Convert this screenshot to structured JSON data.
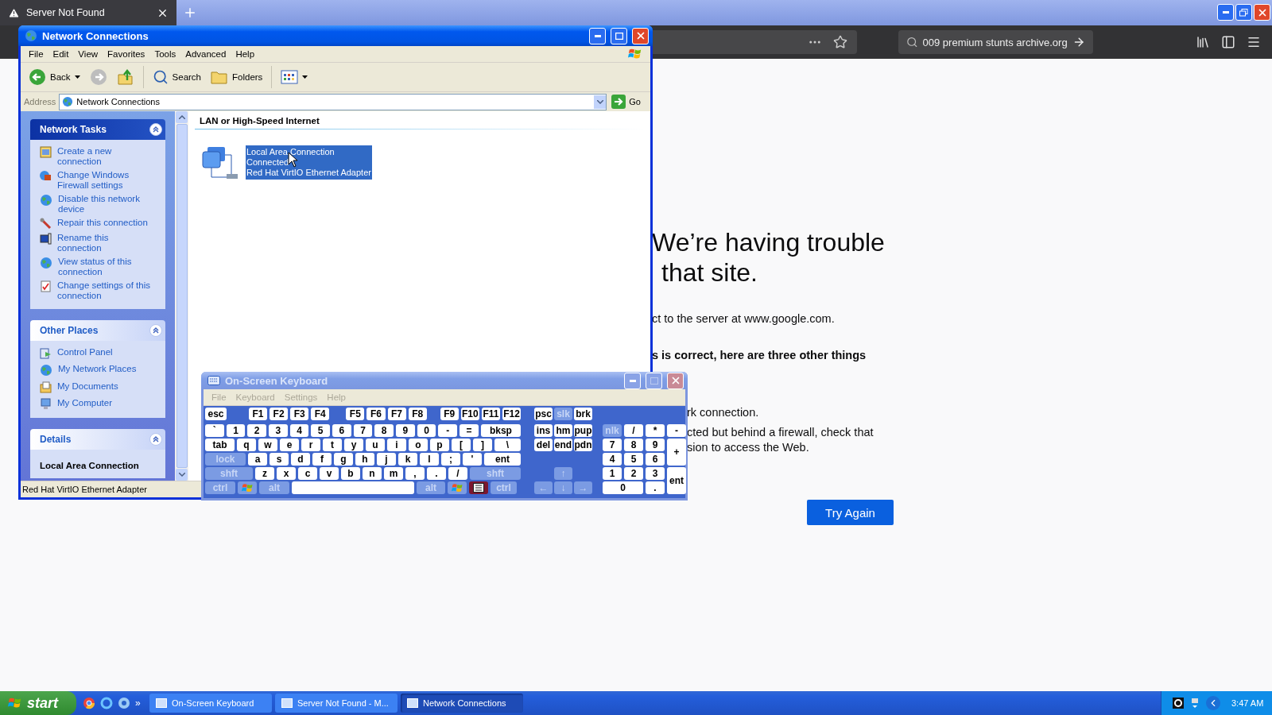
{
  "browser": {
    "tab": {
      "title": "Server Not Found",
      "selected": true
    },
    "search": {
      "value": "009 premium stunts archive.org"
    }
  },
  "error_page": {
    "heading": [
      "We’re having trouble",
      "that site."
    ],
    "lines": [
      {
        "text": "ct to the server at www.google.com.",
        "kind": "plain"
      },
      {
        "text": "s is correct, here are three other things",
        "kind": "bold"
      },
      {
        "text": "rk connection.",
        "kind": "item"
      },
      {
        "text": "cted but behind a firewall, check that",
        "kind": "item"
      },
      {
        "text": "sion to access the Web.",
        "kind": "cont"
      }
    ],
    "button": "Try Again"
  },
  "network_window": {
    "title": "Network Connections",
    "active": true,
    "menu": [
      "File",
      "Edit",
      "View",
      "Favorites",
      "Tools",
      "Advanced",
      "Help"
    ],
    "toolbar": [
      {
        "label": "Back",
        "kind": "back"
      },
      {
        "kind": "forward"
      },
      {
        "kind": "up"
      },
      {
        "label": "Search",
        "kind": "search"
      },
      {
        "label": "Folders",
        "kind": "folders"
      },
      {
        "kind": "views"
      }
    ],
    "address": {
      "label": "Address",
      "value": "Network Connections",
      "go": "Go"
    },
    "panels": [
      {
        "title": "Network Tasks",
        "kind": "primary",
        "expanded": true,
        "items": [
          "Create a new connection",
          "Change Windows Firewall settings",
          "Disable this network device",
          "Repair this connection",
          "Rename this connection",
          "View status of this connection",
          "Change settings of this connection"
        ]
      },
      {
        "title": "Other Places",
        "kind": "links",
        "expanded": true,
        "items": [
          "Control Panel",
          "My Network Places",
          "My Documents",
          "My Computer"
        ]
      },
      {
        "title": "Details",
        "kind": "details",
        "expanded": true,
        "items": [
          "Local Area Connection"
        ]
      }
    ],
    "group": {
      "title": "LAN or High-Speed Internet",
      "item": {
        "lines": [
          "Local Area Connection",
          "Connected",
          "Red Hat VirtIO Ethernet Adapter"
        ],
        "selected": true
      }
    },
    "status": "Red Hat VirtIO Ethernet Adapter"
  },
  "keyboard_window": {
    "title": "On-Screen Keyboard",
    "active": false,
    "menu": [
      "File",
      "Keyboard",
      "Settings",
      "Help"
    ],
    "main_rows": [
      [
        {
          "label": "esc",
          "kind": "key"
        },
        {
          "label": "F1",
          "kind": "key"
        },
        {
          "label": "F2",
          "kind": "key"
        },
        {
          "label": "F3",
          "kind": "key"
        },
        {
          "label": "F4",
          "kind": "key"
        },
        {
          "label": "F5",
          "kind": "key"
        },
        {
          "label": "F6",
          "kind": "key"
        },
        {
          "label": "F7",
          "kind": "key"
        },
        {
          "label": "F8",
          "kind": "key"
        },
        {
          "label": "F9",
          "kind": "key"
        },
        {
          "label": "F10",
          "kind": "key"
        },
        {
          "label": "F11",
          "kind": "key"
        },
        {
          "label": "F12",
          "kind": "key"
        }
      ],
      [
        {
          "label": "`",
          "kind": "key"
        },
        {
          "label": "1",
          "kind": "key"
        },
        {
          "label": "2",
          "kind": "key"
        },
        {
          "label": "3",
          "kind": "key"
        },
        {
          "label": "4",
          "kind": "key"
        },
        {
          "label": "5",
          "kind": "key"
        },
        {
          "label": "6",
          "kind": "key"
        },
        {
          "label": "7",
          "kind": "key"
        },
        {
          "label": "8",
          "kind": "key"
        },
        {
          "label": "9",
          "kind": "key"
        },
        {
          "label": "0",
          "kind": "key"
        },
        {
          "label": "-",
          "kind": "key"
        },
        {
          "label": "=",
          "kind": "key"
        },
        {
          "label": "bksp",
          "kind": "key"
        }
      ],
      [
        {
          "label": "tab",
          "kind": "key"
        },
        {
          "label": "q",
          "kind": "key"
        },
        {
          "label": "w",
          "kind": "key"
        },
        {
          "label": "e",
          "kind": "key"
        },
        {
          "label": "r",
          "kind": "key"
        },
        {
          "label": "t",
          "kind": "key"
        },
        {
          "label": "y",
          "kind": "key"
        },
        {
          "label": "u",
          "kind": "key"
        },
        {
          "label": "i",
          "kind": "key"
        },
        {
          "label": "o",
          "kind": "key"
        },
        {
          "label": "p",
          "kind": "key"
        },
        {
          "label": "[",
          "kind": "key"
        },
        {
          "label": "]",
          "kind": "key"
        },
        {
          "label": "\\",
          "kind": "key"
        }
      ],
      [
        {
          "label": "lock",
          "kind": "pale"
        },
        {
          "label": "a",
          "kind": "key"
        },
        {
          "label": "s",
          "kind": "key"
        },
        {
          "label": "d",
          "kind": "key"
        },
        {
          "label": "f",
          "kind": "key"
        },
        {
          "label": "g",
          "kind": "key"
        },
        {
          "label": "h",
          "kind": "key"
        },
        {
          "label": "j",
          "kind": "key"
        },
        {
          "label": "k",
          "kind": "key"
        },
        {
          "label": "l",
          "kind": "key"
        },
        {
          "label": ";",
          "kind": "key"
        },
        {
          "label": "'",
          "kind": "key"
        },
        {
          "label": "ent",
          "kind": "key"
        }
      ],
      [
        {
          "label": "shft",
          "kind": "pale"
        },
        {
          "label": "z",
          "kind": "key"
        },
        {
          "label": "x",
          "kind": "key"
        },
        {
          "label": "c",
          "kind": "key"
        },
        {
          "label": "v",
          "kind": "key"
        },
        {
          "label": "b",
          "kind": "key"
        },
        {
          "label": "n",
          "kind": "key"
        },
        {
          "label": "m",
          "kind": "key"
        },
        {
          "label": ",",
          "kind": "key"
        },
        {
          "label": ".",
          "kind": "key"
        },
        {
          "label": "/",
          "kind": "key"
        },
        {
          "label": "shft",
          "kind": "pale"
        }
      ],
      [
        {
          "label": "ctrl",
          "kind": "pale"
        },
        {
          "kind": "logo"
        },
        {
          "label": "alt",
          "kind": "pale"
        },
        {
          "kind": "space"
        },
        {
          "label": "alt",
          "kind": "pale"
        },
        {
          "kind": "logo"
        },
        {
          "kind": "menu"
        },
        {
          "label": "ctrl",
          "kind": "pale"
        }
      ]
    ],
    "nav_keys": [
      {
        "label": "psc",
        "kind": "key"
      },
      {
        "label": "slk",
        "kind": "pale"
      },
      {
        "label": "brk",
        "kind": "key"
      },
      {
        "label": "ins",
        "kind": "key"
      },
      {
        "label": "hm",
        "kind": "key"
      },
      {
        "label": "pup",
        "kind": "key"
      },
      {
        "label": "del",
        "kind": "key"
      },
      {
        "label": "end",
        "kind": "key"
      },
      {
        "label": "pdn",
        "kind": "key"
      },
      {
        "label": "↑",
        "kind": "pale"
      },
      {
        "label": "←",
        "kind": "pale"
      },
      {
        "label": "↓",
        "kind": "pale"
      },
      {
        "label": "→",
        "kind": "pale"
      }
    ],
    "numpad_keys": [
      {
        "label": "nlk",
        "kind": "pale"
      },
      {
        "label": "/",
        "kind": "key"
      },
      {
        "label": "*",
        "kind": "key"
      },
      {
        "label": "-",
        "kind": "key"
      },
      {
        "label": "7",
        "kind": "key"
      },
      {
        "label": "8",
        "kind": "key"
      },
      {
        "label": "9",
        "kind": "key"
      },
      {
        "label": "4",
        "kind": "key"
      },
      {
        "label": "5",
        "kind": "key"
      },
      {
        "label": "6",
        "kind": "key"
      },
      {
        "label": "+",
        "kind": "key"
      },
      {
        "label": "1",
        "kind": "key"
      },
      {
        "label": "2",
        "kind": "key"
      },
      {
        "label": "3",
        "kind": "key"
      },
      {
        "label": "0",
        "kind": "key"
      },
      {
        "label": ".",
        "kind": "key"
      },
      {
        "label": "ent",
        "kind": "key"
      }
    ]
  },
  "taskbar": {
    "start": "start",
    "more": "»",
    "tasks": [
      {
        "label": "On-Screen Keyboard",
        "selected": false
      },
      {
        "label": "Server Not Found - M...",
        "selected": false
      },
      {
        "label": "Network Connections",
        "selected": true
      }
    ],
    "clock": "3:47 AM"
  }
}
